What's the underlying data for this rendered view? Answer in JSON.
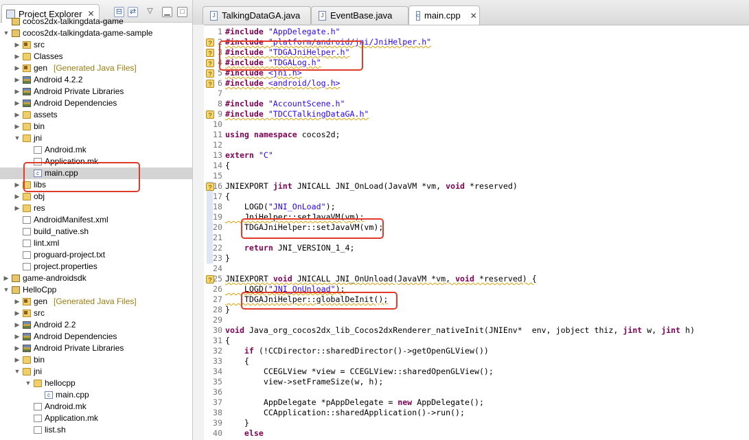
{
  "explorer": {
    "title": "Project Explorer",
    "tree": [
      {
        "label": "cocos2dx-talkingdata-game",
        "level": 0,
        "icon": "project",
        "toggle": ""
      },
      {
        "label": "cocos2dx-talkingdata-game-sample",
        "level": 0,
        "icon": "project",
        "toggle": "open"
      },
      {
        "label": "src",
        "level": 1,
        "icon": "srcfolder",
        "toggle": "closed"
      },
      {
        "label": "Classes",
        "level": 1,
        "icon": "folder",
        "toggle": "closed"
      },
      {
        "label": "gen",
        "suffix": "[Generated Java Files]",
        "level": 1,
        "icon": "srcfolder",
        "toggle": "closed"
      },
      {
        "label": "Android 4.2.2",
        "level": 1,
        "icon": "lib",
        "toggle": "closed"
      },
      {
        "label": "Android Private Libraries",
        "level": 1,
        "icon": "lib",
        "toggle": "closed"
      },
      {
        "label": "Android Dependencies",
        "level": 1,
        "icon": "lib",
        "toggle": "closed"
      },
      {
        "label": "assets",
        "level": 1,
        "icon": "folder",
        "toggle": "closed"
      },
      {
        "label": "bin",
        "level": 1,
        "icon": "folder",
        "toggle": "closed"
      },
      {
        "label": "jni",
        "level": 1,
        "icon": "folder",
        "toggle": "open"
      },
      {
        "label": "Android.mk",
        "level": 2,
        "icon": "file",
        "toggle": ""
      },
      {
        "label": "Application.mk",
        "level": 2,
        "icon": "file",
        "toggle": ""
      },
      {
        "label": "main.cpp",
        "level": 2,
        "icon": "cfile",
        "toggle": "",
        "selected": true
      },
      {
        "label": "libs",
        "level": 1,
        "icon": "folder",
        "toggle": "closed"
      },
      {
        "label": "obj",
        "level": 1,
        "icon": "folder",
        "toggle": "closed"
      },
      {
        "label": "res",
        "level": 1,
        "icon": "folder",
        "toggle": "closed"
      },
      {
        "label": "AndroidManifest.xml",
        "level": 1,
        "icon": "file",
        "toggle": ""
      },
      {
        "label": "build_native.sh",
        "level": 1,
        "icon": "file",
        "toggle": ""
      },
      {
        "label": "lint.xml",
        "level": 1,
        "icon": "file",
        "toggle": ""
      },
      {
        "label": "proguard-project.txt",
        "level": 1,
        "icon": "file",
        "toggle": ""
      },
      {
        "label": "project.properties",
        "level": 1,
        "icon": "file",
        "toggle": ""
      },
      {
        "label": "game-androidsdk",
        "level": 0,
        "icon": "project",
        "toggle": "closed"
      },
      {
        "label": "HelloCpp",
        "level": 0,
        "icon": "project",
        "toggle": "open"
      },
      {
        "label": "gen",
        "suffix": "[Generated Java Files]",
        "level": 1,
        "icon": "srcfolder",
        "toggle": "closed"
      },
      {
        "label": "src",
        "level": 1,
        "icon": "srcfolder",
        "toggle": "closed"
      },
      {
        "label": "Android 2.2",
        "level": 1,
        "icon": "lib",
        "toggle": "closed"
      },
      {
        "label": "Android Dependencies",
        "level": 1,
        "icon": "lib",
        "toggle": "closed"
      },
      {
        "label": "Android Private Libraries",
        "level": 1,
        "icon": "lib",
        "toggle": "closed"
      },
      {
        "label": "bin",
        "level": 1,
        "icon": "folder",
        "toggle": "closed"
      },
      {
        "label": "jni",
        "level": 1,
        "icon": "folder",
        "toggle": "open"
      },
      {
        "label": "hellocpp",
        "level": 2,
        "icon": "folder",
        "toggle": "open"
      },
      {
        "label": "main.cpp",
        "level": 3,
        "icon": "cfile",
        "toggle": ""
      },
      {
        "label": "Android.mk",
        "level": 2,
        "icon": "file",
        "toggle": ""
      },
      {
        "label": "Application.mk",
        "level": 2,
        "icon": "file",
        "toggle": ""
      },
      {
        "label": "list.sh",
        "level": 2,
        "icon": "file",
        "toggle": ""
      }
    ]
  },
  "editor": {
    "tabs": [
      {
        "label": "TalkingDataGA.java",
        "active": false,
        "icon": "J"
      },
      {
        "label": "EventBase.java",
        "active": false,
        "icon": "J"
      },
      {
        "label": "main.cpp",
        "active": true,
        "icon": "c"
      }
    ],
    "lines": [
      {
        "n": "1",
        "t": "#include \"AppDelegate.h\""
      },
      {
        "n": "2",
        "t": "#include \"platform/android/jni/JniHelper.h\"",
        "w": true,
        "m": true
      },
      {
        "n": "3",
        "t": "#include \"TDGAJniHelper.h\"",
        "w": true,
        "m": true
      },
      {
        "n": "4",
        "t": "#include \"TDGALog.h\"",
        "w": true,
        "m": true
      },
      {
        "n": "5",
        "t": "#include <jni.h>",
        "w": true,
        "m": true
      },
      {
        "n": "6",
        "t": "#include <android/log.h>",
        "w": true,
        "m": true
      },
      {
        "n": "7",
        "t": ""
      },
      {
        "n": "8",
        "t": "#include \"AccountScene.h\""
      },
      {
        "n": "9",
        "t": "#include \"TDCCTalkingDataGA.h\"",
        "w": true,
        "m": true
      },
      {
        "n": "10",
        "t": ""
      },
      {
        "n": "11",
        "t": "using namespace cocos2d;"
      },
      {
        "n": "12",
        "t": ""
      },
      {
        "n": "13",
        "t": "extern \"C\""
      },
      {
        "n": "14",
        "t": "{"
      },
      {
        "n": "15",
        "t": ""
      },
      {
        "n": "16",
        "t": "JNIEXPORT jint JNICALL JNI_OnLoad(JavaVM *vm, void *reserved)",
        "m": true
      },
      {
        "n": "17",
        "t": "{"
      },
      {
        "n": "18",
        "t": "    LOGD(\"JNI_OnLoad\");"
      },
      {
        "n": "19",
        "t": "    JniHelper::setJavaVM(vm);",
        "w": true
      },
      {
        "n": "20",
        "t": "    TDGAJniHelper::setJavaVM(vm);"
      },
      {
        "n": "21",
        "t": ""
      },
      {
        "n": "22",
        "t": "    return JNI_VERSION_1_4;"
      },
      {
        "n": "23",
        "t": "}"
      },
      {
        "n": "24",
        "t": ""
      },
      {
        "n": "25",
        "t": "JNIEXPORT void JNICALL JNI_OnUnload(JavaVM *vm, void *reserved) {",
        "w": true,
        "m": true
      },
      {
        "n": "26",
        "t": "    LOGD(\"JNI_OnUnload\");",
        "w": true
      },
      {
        "n": "27",
        "t": "    TDGAJniHelper::globalDeInit();",
        "w": true
      },
      {
        "n": "28",
        "t": "}"
      },
      {
        "n": "29",
        "t": ""
      },
      {
        "n": "30",
        "t": "void Java_org_cocos2dx_lib_Cocos2dxRenderer_nativeInit(JNIEnv*  env, jobject thiz, jint w, jint h)"
      },
      {
        "n": "31",
        "t": "{"
      },
      {
        "n": "32",
        "t": "    if (!CCDirector::sharedDirector()->getOpenGLView())"
      },
      {
        "n": "33",
        "t": "    {"
      },
      {
        "n": "34",
        "t": "        CCEGLView *view = CCEGLView::sharedOpenGLView();"
      },
      {
        "n": "35",
        "t": "        view->setFrameSize(w, h);"
      },
      {
        "n": "36",
        "t": ""
      },
      {
        "n": "37",
        "t": "        AppDelegate *pAppDelegate = new AppDelegate();"
      },
      {
        "n": "38",
        "t": "        CCApplication::sharedApplication()->run();"
      },
      {
        "n": "39",
        "t": "    }"
      },
      {
        "n": "40",
        "t": "    else"
      }
    ]
  },
  "colors": {
    "keyword": "#7f0055",
    "string": "#2a00ff",
    "highlight_box": "#e23a28",
    "warning_marker": "#f5d66e"
  }
}
